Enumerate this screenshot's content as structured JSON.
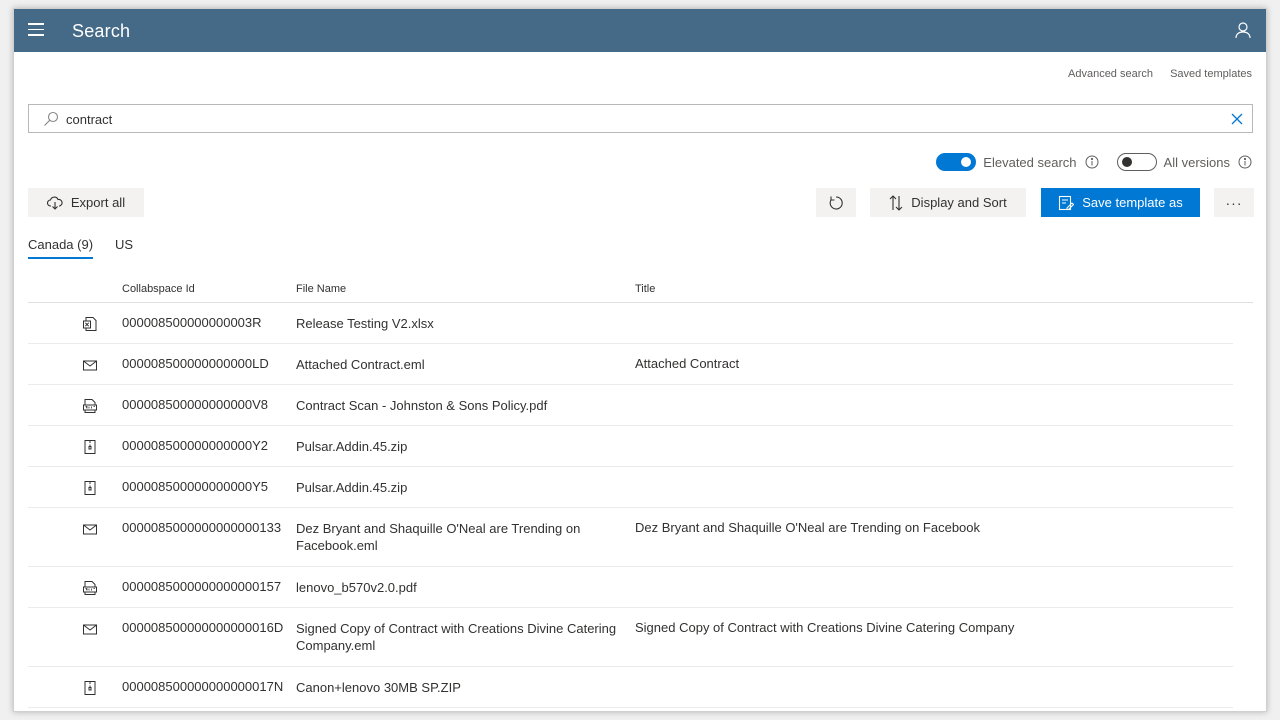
{
  "header": {
    "title": "Search"
  },
  "links": {
    "advanced": "Advanced search",
    "saved": "Saved templates"
  },
  "search": {
    "value": "contract",
    "placeholder": ""
  },
  "toggles": {
    "elevated": {
      "label": "Elevated search",
      "on": true
    },
    "versions": {
      "label": "All versions",
      "on": false
    }
  },
  "toolbar": {
    "export_label": "Export all",
    "display_label": "Display and Sort",
    "save_label": "Save template as",
    "more_label": "···"
  },
  "tabs": [
    {
      "label": "Canada (9)",
      "active": true
    },
    {
      "label": "US",
      "active": false
    }
  ],
  "table": {
    "columns": [
      "Collabspace Id",
      "File Name",
      "Title"
    ],
    "rows": [
      {
        "icon": "excel-file-icon",
        "id": "000008500000000003R",
        "file": "Release Testing V2.xlsx",
        "title": ""
      },
      {
        "icon": "email-icon",
        "id": "000008500000000000LD",
        "file": "Attached Contract.eml",
        "title": "Attached Contract"
      },
      {
        "icon": "pdf-file-icon",
        "id": "000008500000000000V8",
        "file": "Contract Scan - Johnston & Sons Policy.pdf",
        "title": ""
      },
      {
        "icon": "zip-file-icon",
        "id": "000008500000000000Y2",
        "file": "Pulsar.Addin.45.zip",
        "title": ""
      },
      {
        "icon": "zip-file-icon",
        "id": "000008500000000000Y5",
        "file": "Pulsar.Addin.45.zip",
        "title": ""
      },
      {
        "icon": "email-icon",
        "id": "0000085000000000000133",
        "file": "Dez Bryant and Shaquille O'Neal are Trending on Facebook.eml",
        "title": "Dez Bryant and Shaquille O'Neal are Trending on Facebook"
      },
      {
        "icon": "pdf-file-icon",
        "id": "0000085000000000000157",
        "file": "lenovo_b570v2.0.pdf",
        "title": ""
      },
      {
        "icon": "email-icon",
        "id": "000008500000000000016D",
        "file": "Signed Copy of Contract with Creations Divine Catering Company.eml",
        "title": "Signed Copy of Contract with Creations Divine Catering Company"
      },
      {
        "icon": "zip-file-icon",
        "id": "000008500000000000017N",
        "file": "Canon+lenovo 30MB SP.ZIP",
        "title": ""
      }
    ]
  },
  "colors": {
    "header_bg": "#446a87",
    "accent": "#0078d4",
    "button_bg": "#f3f2f1"
  }
}
